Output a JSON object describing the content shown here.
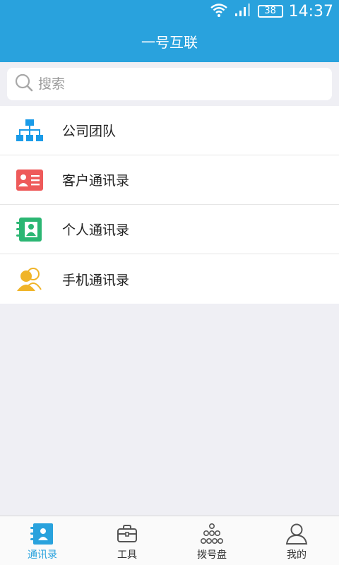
{
  "status": {
    "battery": "38",
    "time": "14:37"
  },
  "header": {
    "title": "一号互联"
  },
  "search": {
    "placeholder": "搜索"
  },
  "list": {
    "items": [
      {
        "label": "公司团队",
        "icon": "org-chart-icon",
        "color": "#1a9be8"
      },
      {
        "label": "客户通讯录",
        "icon": "contact-card-icon",
        "color": "#ee5a5a"
      },
      {
        "label": "个人通讯录",
        "icon": "address-book-icon",
        "color": "#2bb673"
      },
      {
        "label": "手机通讯录",
        "icon": "phone-contacts-icon",
        "color": "#f0b429"
      }
    ]
  },
  "tabs": [
    {
      "label": "通讯录",
      "icon": "contacts-tab-icon",
      "active": true
    },
    {
      "label": "工具",
      "icon": "toolbox-icon",
      "active": false
    },
    {
      "label": "拨号盘",
      "icon": "dialpad-icon",
      "active": false
    },
    {
      "label": "我的",
      "icon": "profile-icon",
      "active": false
    }
  ],
  "colors": {
    "accent": "#29a2dd",
    "background": "#efeff4"
  }
}
